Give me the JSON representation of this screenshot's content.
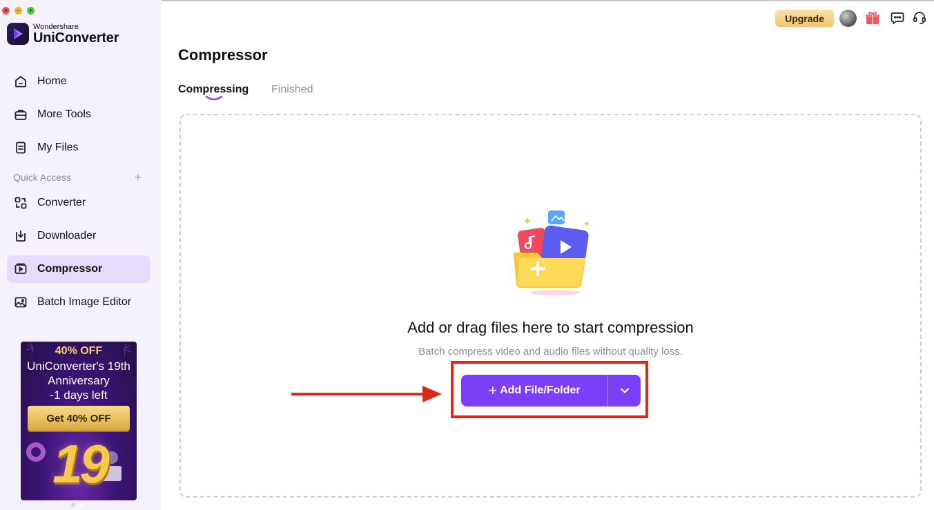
{
  "window": {
    "controls": [
      "×",
      "–",
      "+"
    ]
  },
  "app": {
    "brand": "Wondershare",
    "name": "UniConverter"
  },
  "sidebar": {
    "items": [
      {
        "label": "Home",
        "icon": "home-icon"
      },
      {
        "label": "More Tools",
        "icon": "toolbox-icon"
      },
      {
        "label": "My Files",
        "icon": "file-icon"
      }
    ],
    "quick_access": {
      "label": "Quick Access",
      "add_symbol": "+",
      "items": [
        {
          "label": "Converter",
          "icon": "converter-icon"
        },
        {
          "label": "Downloader",
          "icon": "downloader-icon"
        },
        {
          "label": "Compressor",
          "icon": "compressor-icon",
          "active": true
        },
        {
          "label": "Batch Image Editor",
          "icon": "image-editor-icon"
        }
      ]
    },
    "promo": {
      "line1": "40% OFF",
      "line2": "UniConverter's 19th",
      "line3": "Anniversary",
      "line4": "-1 days left",
      "button": "Get 40% OFF",
      "big_number": "19"
    }
  },
  "header": {
    "upgrade_label": "Upgrade",
    "icons": [
      "avatar",
      "gift-icon",
      "chat-icon",
      "headset-icon"
    ]
  },
  "main": {
    "title": "Compressor",
    "tabs": [
      {
        "label": "Compressing",
        "active": true
      },
      {
        "label": "Finished",
        "active": false
      }
    ],
    "dropzone": {
      "title": "Add or drag files here to start compression",
      "subtitle": "Batch compress video and audio files without quality loss.",
      "add_button": "Add File/Folder"
    }
  },
  "colors": {
    "accent": "#7a3ff7",
    "sidebar_bg": "#f5f1fd",
    "active_item_bg": "#e6dcfb",
    "annotation_red": "#d8291b",
    "upgrade_gold": "#f1c56f"
  }
}
